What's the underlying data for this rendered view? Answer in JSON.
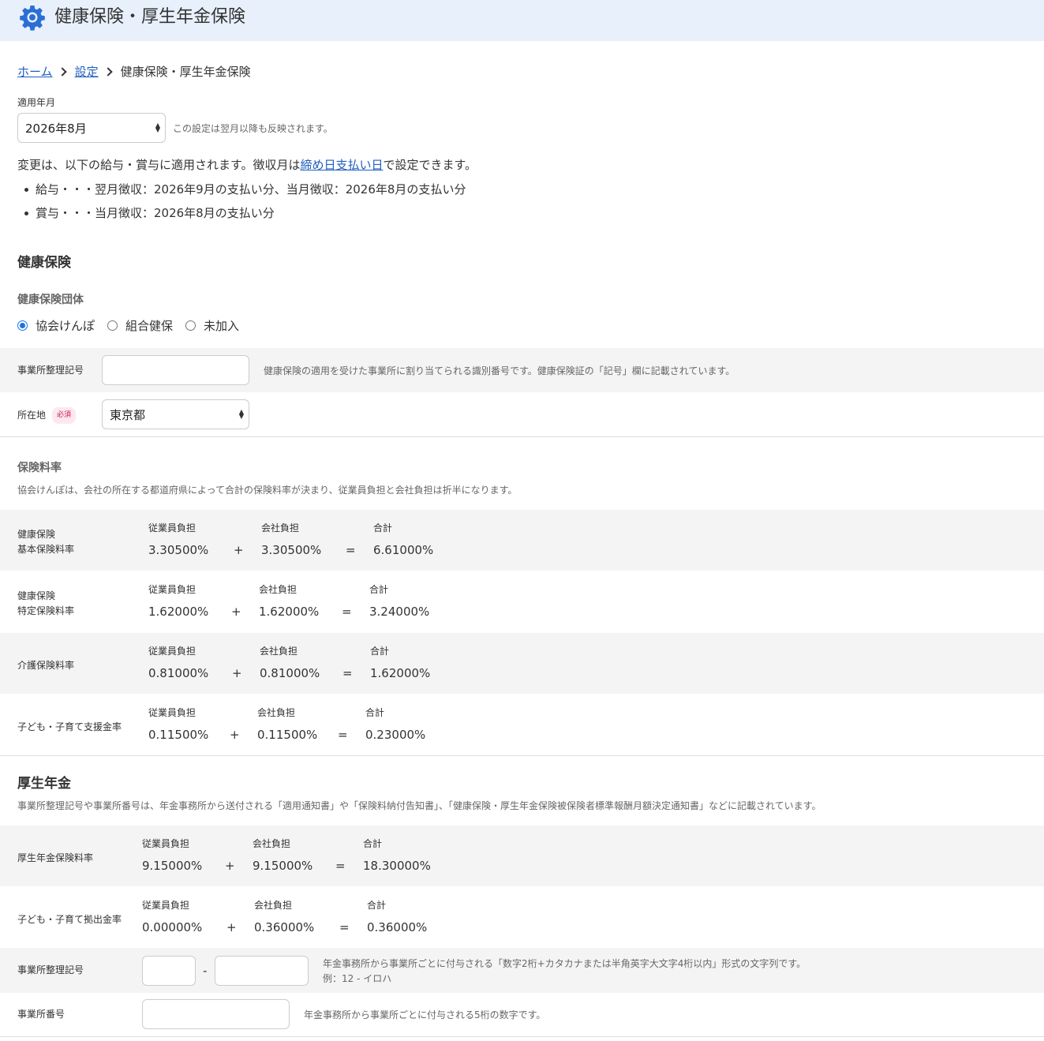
{
  "header": {
    "title": "健康保険・厚生年金保険",
    "icon": "gear-icon"
  },
  "breadcrumb": {
    "home": "ホーム",
    "settings": "設定",
    "current": "健康保険・厚生年金保険"
  },
  "apply_month": {
    "label": "適用年月",
    "value": "2026年8月",
    "hint": "この設定は翌月以降も反映されます。"
  },
  "notice": {
    "before_link": "変更は、以下の給与・賞与に適用されます。徴収月は",
    "link": "締め日支払い日",
    "after_link": "で設定できます。",
    "items": [
      "給与・・・翌月徴収：2026年9月の支払い分、当月徴収：2026年8月の支払い分",
      "賞与・・・当月徴収：2026年8月の支払い分"
    ]
  },
  "health": {
    "heading": "健康保険",
    "org_heading": "健康保険団体",
    "radios": [
      {
        "label": "協会けんぽ",
        "checked": true
      },
      {
        "label": "組合健保",
        "checked": false
      },
      {
        "label": "未加入",
        "checked": false
      }
    ],
    "office_code_label": "事業所整理記号",
    "office_code_hint": "健康保険の適用を受けた事業所に割り当てられる識別番号です。健康保険証の「記号」欄に記載されています。",
    "location_label": "所在地",
    "required": "必須",
    "location_value": "東京都",
    "rate_heading": "保険料率",
    "rate_note": "協会けんぽは、会社の所在する都道府県によって合計の保険料率が決まり、従業員負担と会社負担は折半になります。"
  },
  "captions": {
    "employee": "従業員負担",
    "company": "会社負担",
    "total": "合計",
    "plus": "+",
    "equals": "="
  },
  "health_rates": [
    {
      "label1": "健康保険",
      "label2": "基本保険料率",
      "employee": "3.30500%",
      "company": "3.30500%",
      "total": "6.61000%"
    },
    {
      "label1": "健康保険",
      "label2": "特定保険料率",
      "employee": "1.62000%",
      "company": "1.62000%",
      "total": "3.24000%"
    },
    {
      "label1": "介護保険料率",
      "label2": "",
      "employee": "0.81000%",
      "company": "0.81000%",
      "total": "1.62000%"
    },
    {
      "label1": "子ども・子育て支援金率",
      "label2": "",
      "employee": "0.11500%",
      "company": "0.11500%",
      "total": "0.23000%"
    }
  ],
  "pension": {
    "heading": "厚生年金",
    "note": "事業所整理記号や事業所番号は、年金事務所から送付される「適用通知書」や「保険料納付告知書」、「健康保険・厚生年金保険被保険者標準報酬月額決定通知書」などに記載されています。",
    "office_code_label": "事業所整理記号",
    "dash": "-",
    "office_code_hint1": "年金事務所から事業所ごとに付与される「数字2桁+カタカナまたは半角英字大文字4桁以内」形式の文字列です。",
    "office_code_hint2": "例：12 - イロハ",
    "office_number_label": "事業所番号",
    "office_number_hint": "年金事務所から事業所ごとに付与される5桁の数字です。"
  },
  "pension_rates": [
    {
      "label1": "厚生年金保険料率",
      "label2": "",
      "employee": "9.15000%",
      "company": "9.15000%",
      "total": "18.30000%"
    },
    {
      "label1": "子ども・子育て拠出金率",
      "label2": "",
      "employee": "0.00000%",
      "company": "0.36000%",
      "total": "0.36000%"
    }
  ]
}
